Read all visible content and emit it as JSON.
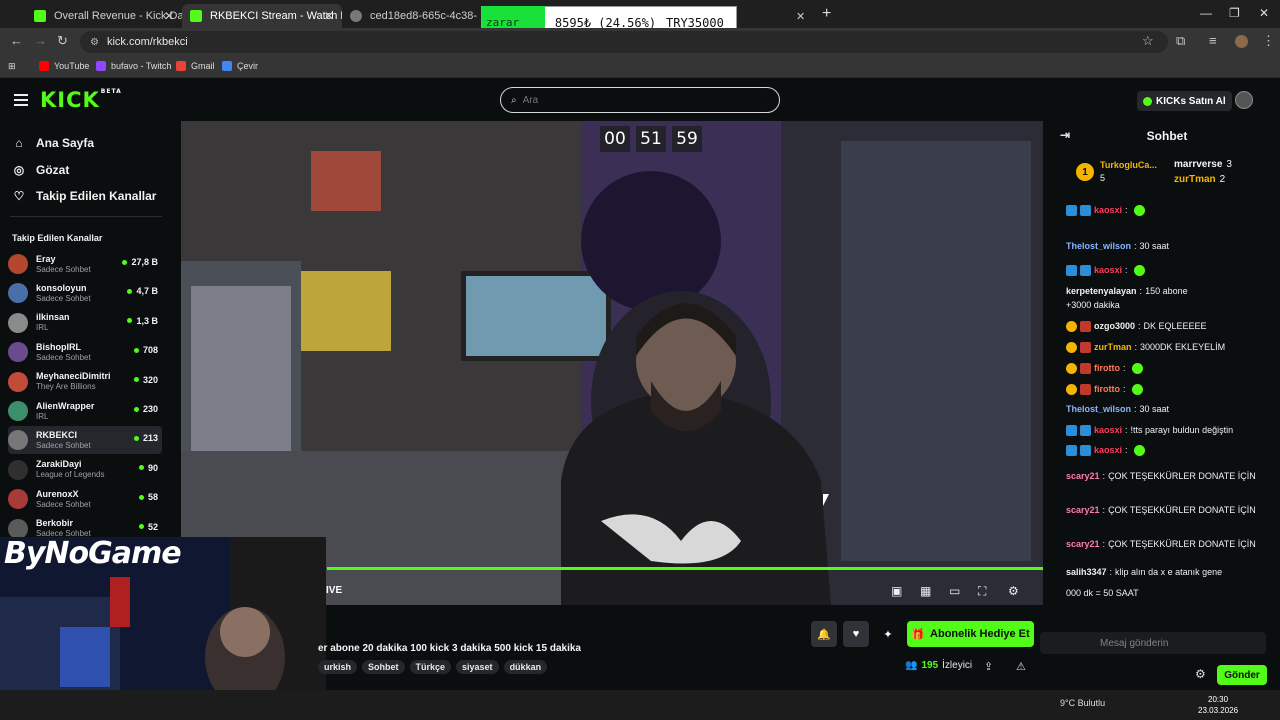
{
  "browser": {
    "tabs": [
      {
        "title": "Overall Revenue - Kick Dashbo",
        "color": "#53fc18"
      },
      {
        "title": "RKBEKCI Stream - Watch Li",
        "color": "#53fc18"
      },
      {
        "title": "ced18ed8-665c-4c38-abf5-85a",
        "color": "#777777"
      }
    ],
    "url": "kick.com/rkbekci",
    "bookmarks": [
      "YouTube",
      "bufavo - Twitch",
      "Gmail",
      "Çevir"
    ]
  },
  "overlay": {
    "zarar": "zarar",
    "amount": "8595₺ (24.56%)",
    "target": "TRY35000"
  },
  "kick": {
    "logo": "KICK",
    "logo_sup": "BETA",
    "search_placeholder": "Ara",
    "buy_label": "KICKs Satın Al"
  },
  "sidebar": {
    "nav": [
      {
        "label": "Ana Sayfa",
        "icon": "home-icon"
      },
      {
        "label": "Gözat",
        "icon": "compass-icon"
      },
      {
        "label": "Takip Edilen Kanallar",
        "icon": "heart-icon"
      }
    ],
    "section_title": "Takip Edilen Kanallar",
    "channels": [
      {
        "name": "Eray",
        "category": "Sadece Sohbet",
        "viewers": "27,8 B",
        "color": "#b3462f"
      },
      {
        "name": "konsoloyun",
        "category": "Sadece Sohbet",
        "viewers": "4,7 B",
        "color": "#4a6ea8"
      },
      {
        "name": "ilkinsan",
        "category": "IRL",
        "viewers": "1,3 B",
        "color": "#8a8a8a"
      },
      {
        "name": "BishopIRL",
        "category": "Sadece Sohbet",
        "viewers": "708",
        "color": "#6b4b8f"
      },
      {
        "name": "MeyhaneciDimitri",
        "category": "They Are Billions",
        "viewers": "320",
        "color": "#c24b3a"
      },
      {
        "name": "AlienWrapper",
        "category": "IRL",
        "viewers": "230",
        "color": "#3b8f6b"
      },
      {
        "name": "RKBEKCI",
        "category": "Sadece Sohbet",
        "viewers": "213",
        "color": "#777777"
      },
      {
        "name": "ZarakiDayi",
        "category": "League of Legends",
        "viewers": "90",
        "color": "#2f2f2f"
      },
      {
        "name": "AurenoxX",
        "category": "Sadece Sohbet",
        "viewers": "58",
        "color": "#a83a3a"
      },
      {
        "name": "Berkobir",
        "category": "Sadece Sohbet",
        "viewers": "52",
        "color": "#5a5a5a"
      }
    ]
  },
  "stream": {
    "timer": [
      "00",
      "51",
      "59"
    ],
    "live_label": "IVE",
    "title": "er abone 20 dakika 100 kick 3 dakika 500 kick 15 dakika",
    "tags": [
      "urkish",
      "Sohbet",
      "Türkçe",
      "siyaset",
      "dükkan"
    ],
    "gift_label": "Abonelik Hediye Et",
    "viewer_count": "195",
    "viewer_label": "İzleyici",
    "overlay_brand": "ByNoGame"
  },
  "chat": {
    "title": "Sohbet",
    "pinned": {
      "rank": "1",
      "name": "TurkogluCa...",
      "count": "5",
      "right": [
        {
          "name": "marrverse",
          "count": "3"
        },
        {
          "name": "zurTman",
          "count": "2"
        }
      ]
    },
    "messages": [
      {
        "user": "kaosxi",
        "text": "",
        "color": "#ff3b5c"
      },
      {
        "user": "Thelost_wilson",
        "text": "30 saat",
        "color": "#8ab4ff"
      },
      {
        "user": "kaosxi",
        "text": "",
        "color": "#ff3b5c"
      },
      {
        "user": "kerpetenyalayan",
        "text": "150 abone",
        "color": "#f0f0f0"
      },
      {
        "user": "",
        "text": "+3000 dakika",
        "color": "#f0f0f0"
      },
      {
        "user": "ozgo3000",
        "text": "DK EQLEEEEE",
        "color": "#f0f0f0"
      },
      {
        "user": "zurTman",
        "text": "3000DK EKLEYELİM",
        "color": "#f5b400"
      },
      {
        "user": "firotto",
        "text": "",
        "color": "#ff7a5a"
      },
      {
        "user": "firotto",
        "text": "",
        "color": "#ff7a5a"
      },
      {
        "user": "Thelost_wilson",
        "text": "30 saat",
        "color": "#8ab4ff"
      },
      {
        "user": "kaosxi",
        "text": "!tts parayı buldun değiştin",
        "color": "#ff3b5c"
      },
      {
        "user": "kaosxi",
        "text": "",
        "color": "#ff3b5c"
      },
      {
        "user": "scary21",
        "text": "ÇOK TEŞEKKÜRLER DONATE İÇİN",
        "color": "#ff7ab0"
      },
      {
        "user": "scary21",
        "text": "ÇOK TEŞEKKÜRLER DONATE İÇİN",
        "color": "#ff7ab0"
      },
      {
        "user": "scary21",
        "text": "ÇOK TEŞEKKÜRLER DONATE İÇİN",
        "color": "#ff7ab0"
      },
      {
        "user": "salih3347",
        "text": "klip alın da x e atanık gene",
        "color": "#f0f0f0"
      },
      {
        "user": "",
        "text": "000 dk = 50 SAAT",
        "color": "#f0f0f0"
      }
    ],
    "input_placeholder": "Mesaj gönderin",
    "send_label": "Gönder"
  },
  "taskbar": {
    "time": "20:30",
    "date": "23.03.2026",
    "weather": "9°C Bulutlu"
  },
  "colors": {
    "kick_green": "#53fc18",
    "bg": "#0b0e0f"
  }
}
